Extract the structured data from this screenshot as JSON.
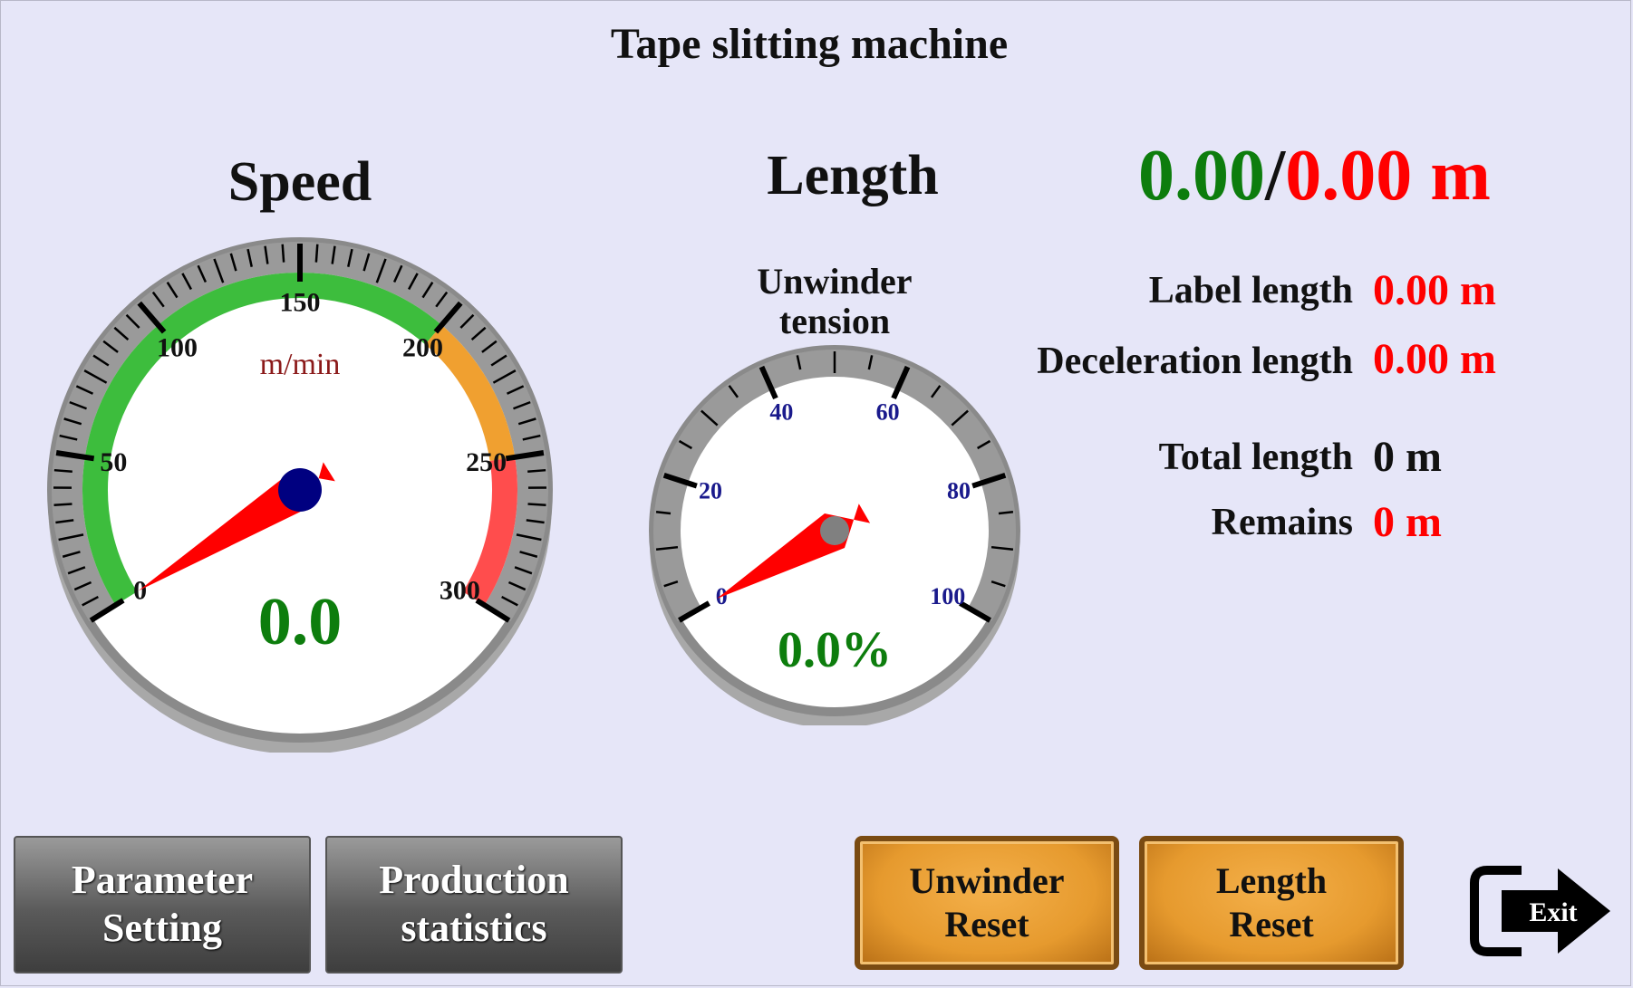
{
  "window": {
    "title": "Tape slitting machine"
  },
  "speed_gauge": {
    "title": "Speed",
    "unit": "m/min",
    "min": 0,
    "max": 300,
    "ticks": [
      "0",
      "50",
      "100",
      "150",
      "200",
      "250",
      "300"
    ],
    "value": 0.0,
    "readout": "0.0",
    "zones": [
      {
        "from": 0,
        "to": 200,
        "color": "#3dbd3d"
      },
      {
        "from": 200,
        "to": 250,
        "color": "#f0a030"
      },
      {
        "from": 250,
        "to": 300,
        "color": "#ff4d4d"
      }
    ]
  },
  "length_title": "Length",
  "tension_gauge": {
    "title_line1": "Unwinder",
    "title_line2": "tension",
    "min": 0,
    "max": 100,
    "ticks": [
      "0",
      "20",
      "40",
      "60",
      "80",
      "100"
    ],
    "value": 0.0,
    "readout": "0.0%"
  },
  "length_display": {
    "current": "0.00",
    "separator": "/",
    "target": "0.00 m"
  },
  "stats": {
    "label_length": {
      "label": "Label length",
      "value": "0.00 m"
    },
    "deceleration_length": {
      "label": "Deceleration length",
      "value": "0.00 m"
    },
    "total_length": {
      "label": "Total length",
      "value": "0 m"
    },
    "remains": {
      "label": "Remains",
      "value": "0 m"
    }
  },
  "buttons": {
    "parameter_setting": {
      "line1": "Parameter",
      "line2": "Setting"
    },
    "production_statistics": {
      "line1": "Production",
      "line2": "statistics"
    },
    "unwinder_reset": {
      "line1": "Unwinder",
      "line2": "Reset"
    },
    "length_reset": {
      "line1": "Length",
      "line2": "Reset"
    },
    "exit": {
      "label": "Exit"
    }
  },
  "colors": {
    "background": "#e6e6f8",
    "value_green": "#0d7d0d",
    "value_red": "#ff0000",
    "needle": "#ff0000",
    "hub_speed": "#000080",
    "hub_tension": "#808080"
  }
}
